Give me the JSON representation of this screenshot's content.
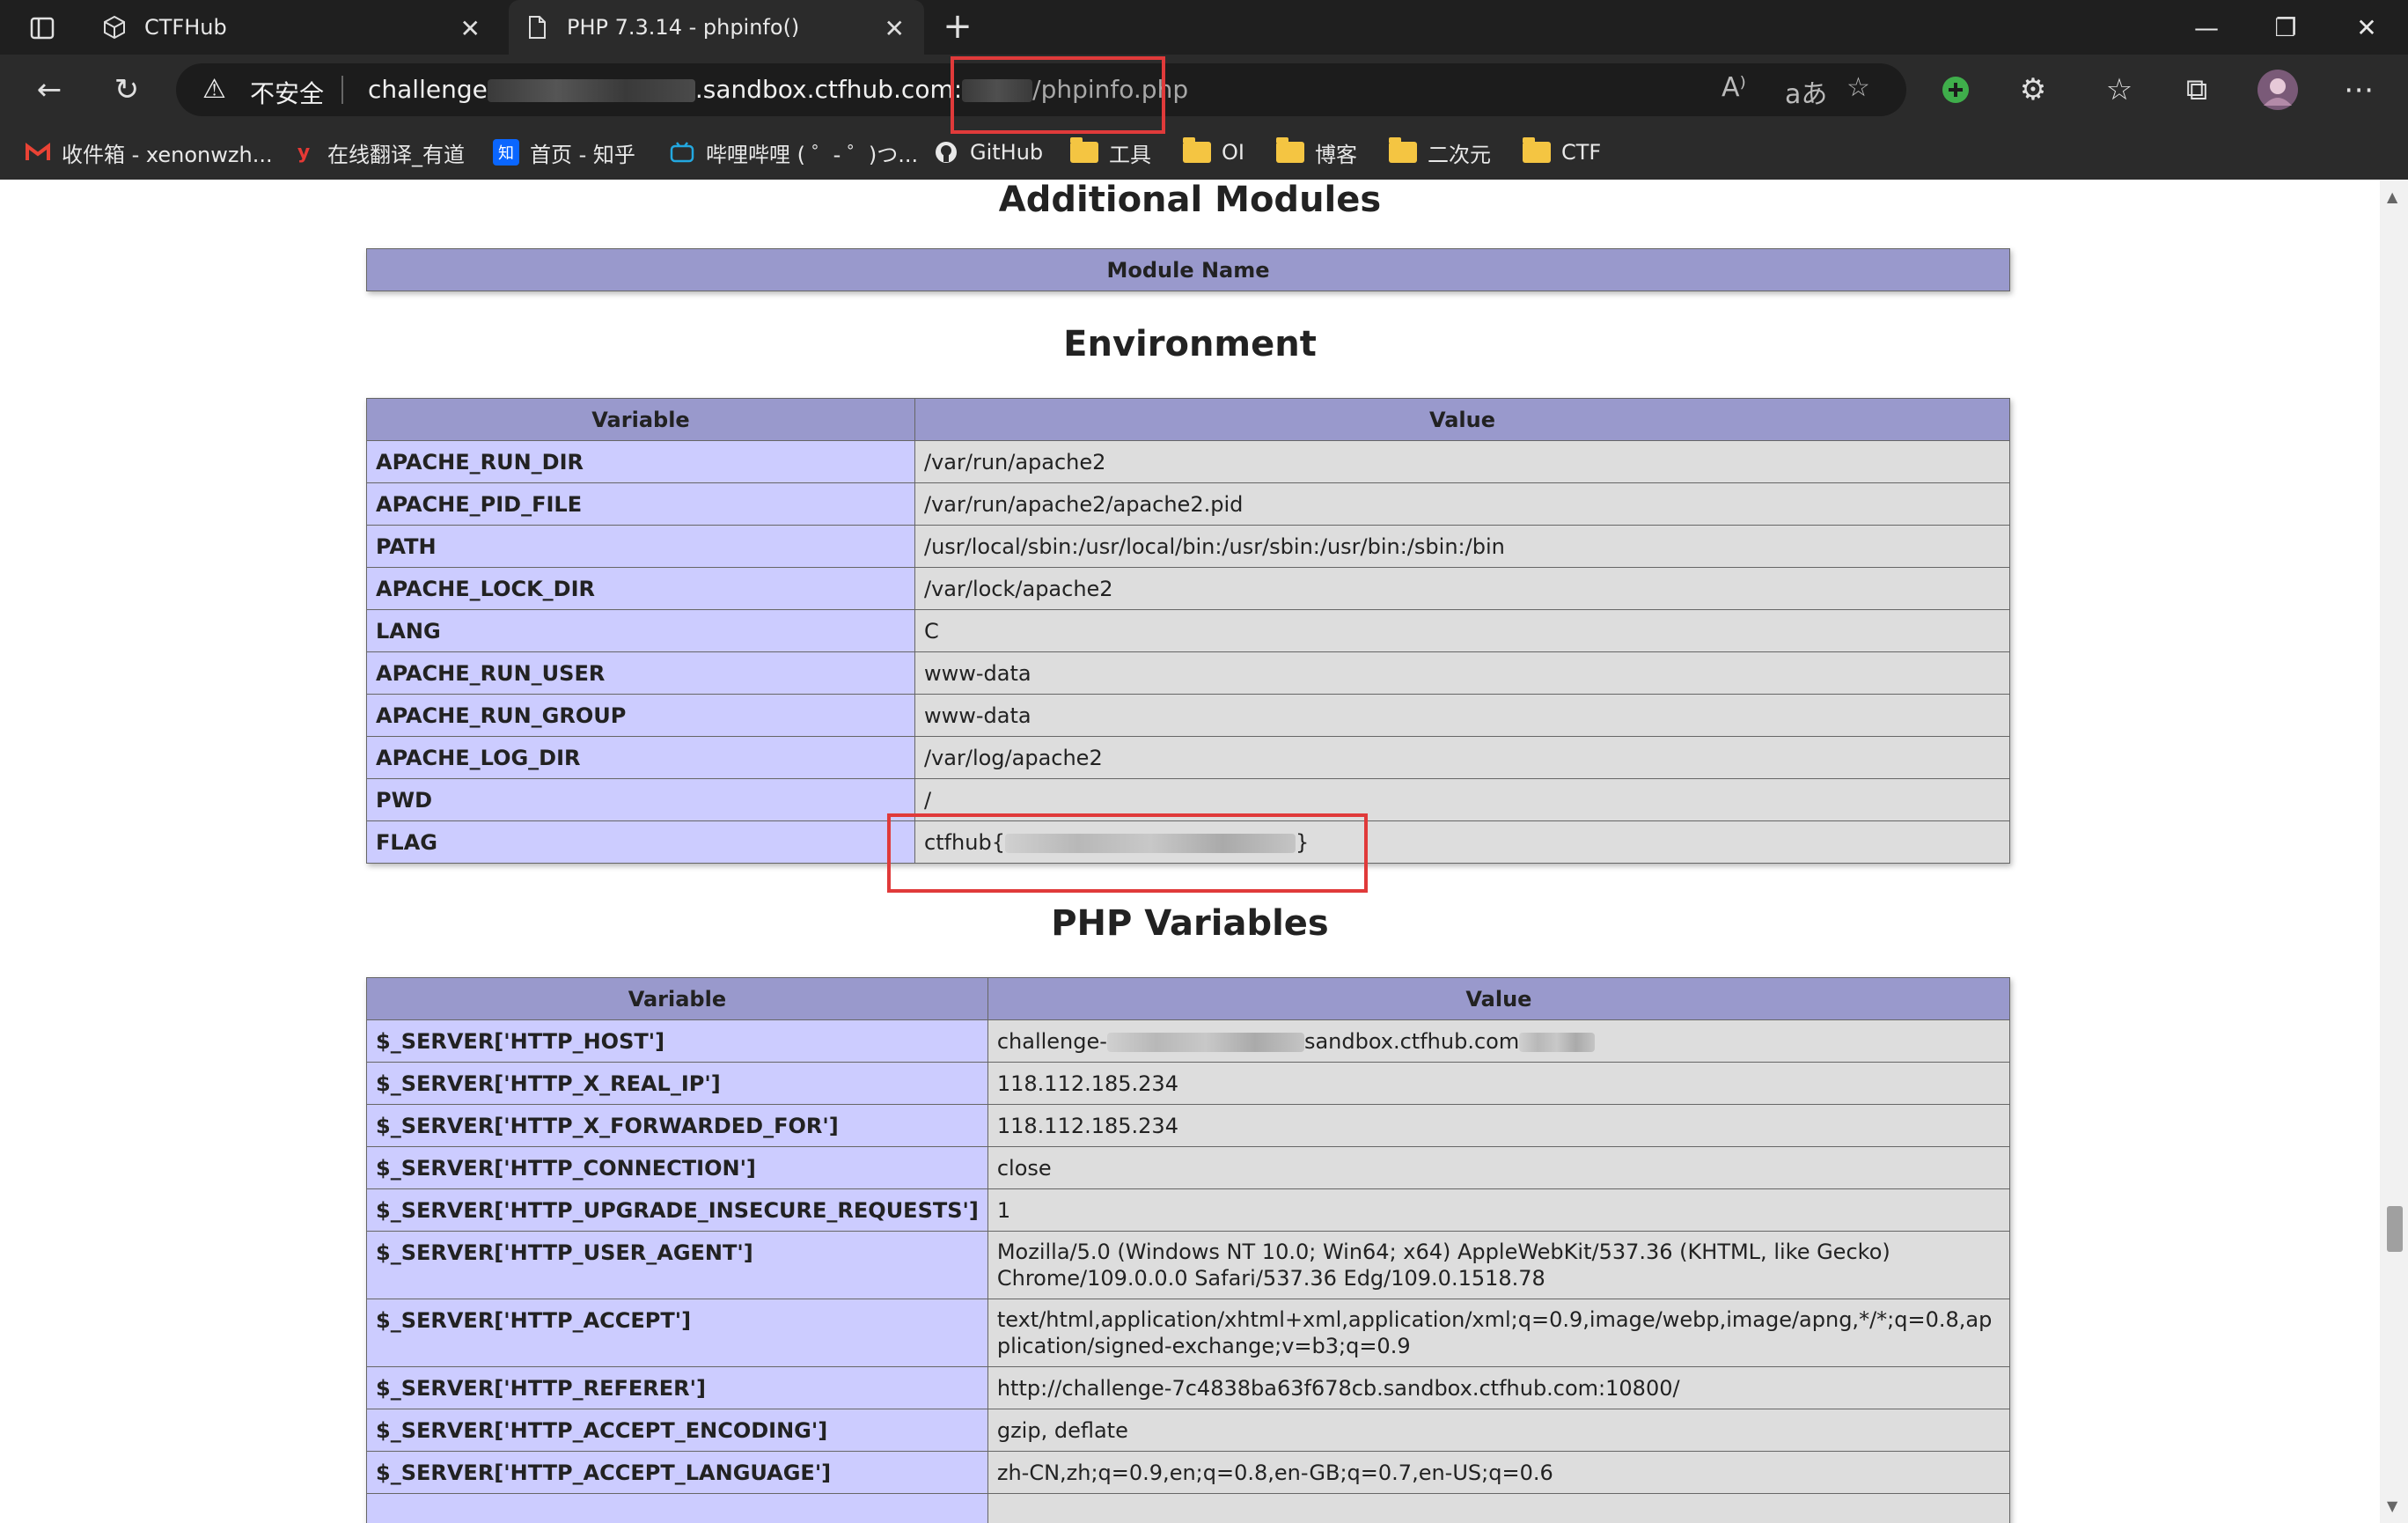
{
  "browser": {
    "tabs": [
      {
        "title": "CTFHub",
        "icon": "cube-icon",
        "active": false
      },
      {
        "title": "PHP 7.3.14 - phpinfo()",
        "icon": "page-icon",
        "active": true
      }
    ],
    "new_tab": "+",
    "address": {
      "insecure_label": "不安全",
      "url_prefix": "challenge",
      "url_domain": ".sandbox.ctfhub.com:",
      "url_path": "/phpinfo.php"
    },
    "bookmarks": [
      {
        "label": "收件箱 - xenonwzh...",
        "icon": "gmail-icon"
      },
      {
        "label": "在线翻译_有道",
        "icon": "youdao-icon"
      },
      {
        "label": "首页 - 知乎",
        "icon": "zhihu-icon"
      },
      {
        "label": "哔哩哔哩 ( ゜- ゜)つ...",
        "icon": "bilibili-icon"
      },
      {
        "label": "GitHub",
        "icon": "github-icon"
      },
      {
        "label": "工具",
        "icon": "folder-icon"
      },
      {
        "label": "OI",
        "icon": "folder-icon"
      },
      {
        "label": "博客",
        "icon": "folder-icon"
      },
      {
        "label": "二次元",
        "icon": "folder-icon"
      },
      {
        "label": "CTF",
        "icon": "folder-icon"
      }
    ]
  },
  "page": {
    "modules": {
      "heading": "Additional Modules",
      "column": "Module Name"
    },
    "environment": {
      "heading": "Environment",
      "col_variable": "Variable",
      "col_value": "Value",
      "rows": [
        {
          "k": "APACHE_RUN_DIR",
          "v": "/var/run/apache2"
        },
        {
          "k": "APACHE_PID_FILE",
          "v": "/var/run/apache2/apache2.pid"
        },
        {
          "k": "PATH",
          "v": "/usr/local/sbin:/usr/local/bin:/usr/sbin:/usr/bin:/sbin:/bin"
        },
        {
          "k": "APACHE_LOCK_DIR",
          "v": "/var/lock/apache2"
        },
        {
          "k": "LANG",
          "v": "C"
        },
        {
          "k": "APACHE_RUN_USER",
          "v": "www-data"
        },
        {
          "k": "APACHE_RUN_GROUP",
          "v": "www-data"
        },
        {
          "k": "APACHE_LOG_DIR",
          "v": "/var/log/apache2"
        },
        {
          "k": "PWD",
          "v": "/"
        }
      ],
      "flag": {
        "k": "FLAG",
        "prefix": "ctfhub{",
        "suffix": "}"
      }
    },
    "php_variables": {
      "heading": "PHP Variables",
      "col_variable": "Variable",
      "col_value": "Value",
      "host": {
        "k": "$_SERVER['HTTP_HOST']",
        "prefix": "challenge-",
        "domain": "sandbox.ctfhub.com"
      },
      "rows": [
        {
          "k": "$_SERVER['HTTP_X_REAL_IP']",
          "v": "118.112.185.234"
        },
        {
          "k": "$_SERVER['HTTP_X_FORWARDED_FOR']",
          "v": "118.112.185.234"
        },
        {
          "k": "$_SERVER['HTTP_CONNECTION']",
          "v": "close"
        },
        {
          "k": "$_SERVER['HTTP_UPGRADE_INSECURE_REQUESTS']",
          "v": "1"
        }
      ],
      "user_agent": {
        "k": "$_SERVER['HTTP_USER_AGENT']",
        "v": "Mozilla/5.0 (Windows NT 10.0; Win64; x64) AppleWebKit/537.36 (KHTML, like Gecko) Chrome/109.0.0.0 Safari/537.36 Edg/109.0.1518.78"
      },
      "accept": {
        "k": "$_SERVER['HTTP_ACCEPT']",
        "v": "text/html,application/xhtml+xml,application/xml;q=0.9,image/webp,image/apng,*/*;q=0.8,application/signed-exchange;v=b3;q=0.9"
      },
      "rows2": [
        {
          "k": "$_SERVER['HTTP_REFERER']",
          "v": "http://challenge-7c4838ba63f678cb.sandbox.ctfhub.com:10800/"
        },
        {
          "k": "$_SERVER['HTTP_ACCEPT_ENCODING']",
          "v": "gzip, deflate"
        },
        {
          "k": "$_SERVER['HTTP_ACCEPT_LANGUAGE']",
          "v": "zh-CN,zh;q=0.9,en;q=0.8,en-GB;q=0.7,en-US;q=0.6"
        }
      ]
    }
  }
}
